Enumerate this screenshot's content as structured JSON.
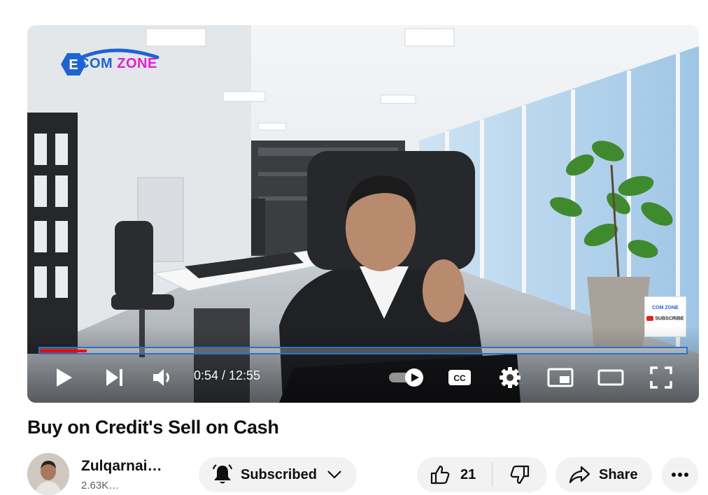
{
  "player": {
    "logo": {
      "prefix_letter": "E",
      "brand_com": "COM",
      "brand_zone": "ZONE"
    },
    "watermark": {
      "line1": "COM ZONE",
      "line2": "SUBSCRIBE"
    },
    "time_display": "0:54 / 12:55",
    "progress_fraction": 0.073,
    "buttons": {
      "play": "play-icon",
      "next": "next-icon",
      "volume": "volume-icon",
      "autoplay": "autoplay-toggle",
      "captions": "CC",
      "settings": "gear-icon",
      "miniplayer": "miniplayer-icon",
      "theater": "theater-icon",
      "fullscreen": "fullscreen-icon"
    }
  },
  "video": {
    "title": "Buy on Credit's Sell on Cash"
  },
  "channel": {
    "name": "Zulqarnai…",
    "subscribers": "2.63K…"
  },
  "actions": {
    "subscribe_label": "Subscribed",
    "like_count": "21",
    "share_label": "Share"
  },
  "colors": {
    "progress_played": "#ff0000",
    "progress_border": "#2f6fd0",
    "logo_blue": "#1e63d6",
    "logo_magenta": "#e01fd2",
    "pill_bg": "#f2f2f2"
  }
}
